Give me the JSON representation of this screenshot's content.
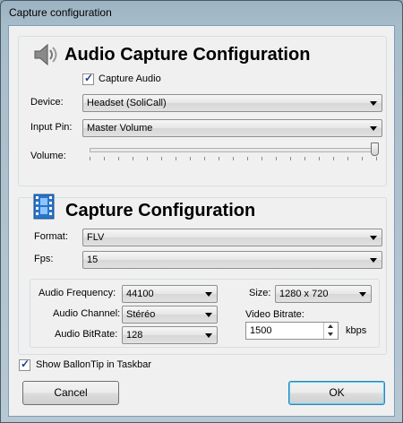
{
  "window": {
    "title": "Capture configuration"
  },
  "audio_section": {
    "heading": "Audio Capture Configuration",
    "capture_audio_label": "Capture Audio",
    "device_label": "Device:",
    "device_value": "Headset (SoliCall)",
    "input_pin_label": "Input Pin:",
    "input_pin_value": "Master Volume",
    "volume_label": "Volume:",
    "volume_level": 1.0
  },
  "capture_section": {
    "heading": "Capture Configuration",
    "format_label": "Format:",
    "format_value": "FLV",
    "fps_label": "Fps:",
    "fps_value": "15",
    "audio_frequency_label": "Audio Frequency:",
    "audio_frequency_value": "44100",
    "audio_channel_label": "Audio Channel:",
    "audio_channel_value": "Stéréo",
    "audio_bitrate_label": "Audio BitRate:",
    "audio_bitrate_value": "128",
    "size_label": "Size:",
    "size_value": "1280 x 720",
    "video_bitrate_label": "Video Bitrate:",
    "video_bitrate_value": "1500",
    "video_bitrate_unit": "kbps"
  },
  "balloon_tip_label": "Show BallonTip in Taskbar",
  "buttons": {
    "cancel": "Cancel",
    "ok": "OK"
  },
  "icons": {
    "audio": "speaker-icon",
    "capture": "film-icon"
  }
}
